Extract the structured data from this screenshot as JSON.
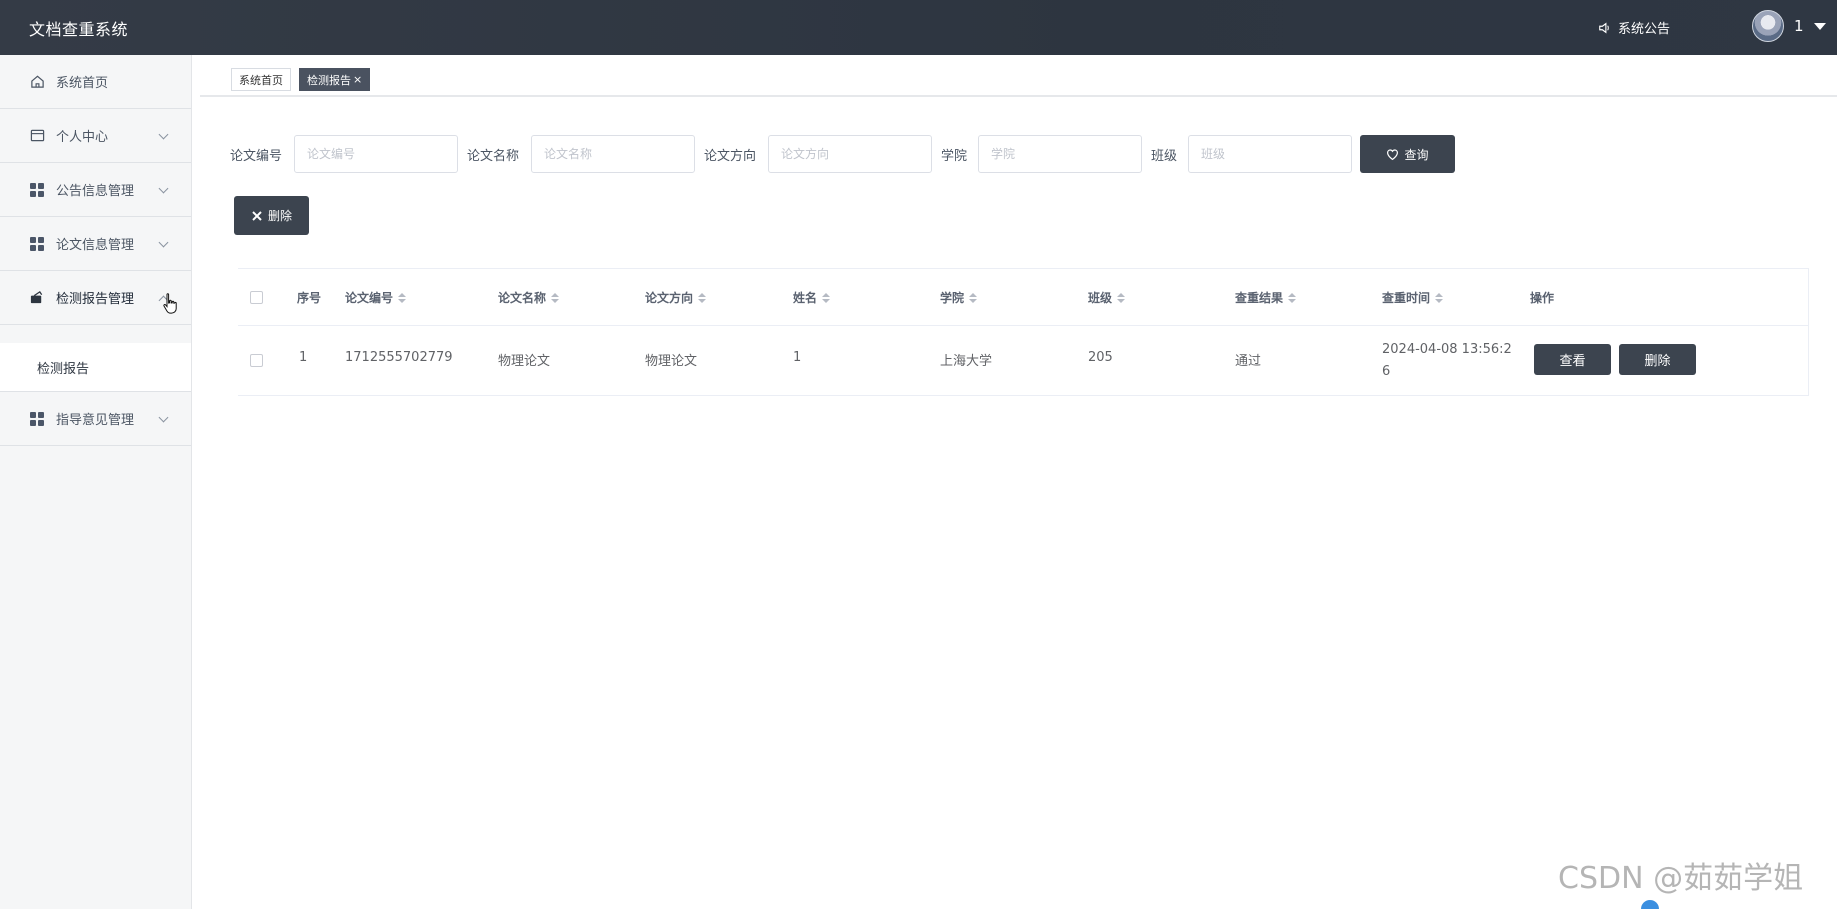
{
  "header": {
    "app_title": "文档查重系统",
    "notice_label": "系统公告",
    "user_name": "1"
  },
  "sidebar": {
    "items": [
      {
        "label": "系统首页",
        "icon": "home-icon"
      },
      {
        "label": "个人中心",
        "icon": "profile-card-icon"
      },
      {
        "label": "公告信息管理",
        "icon": "grid-icon"
      },
      {
        "label": "论文信息管理",
        "icon": "grid-icon"
      },
      {
        "label": "检测报告管理",
        "icon": "report-icon"
      },
      {
        "label": "指导意见管理",
        "icon": "grid-icon"
      }
    ],
    "submenu_label": "检测报告"
  },
  "tabs": {
    "home": "系统首页",
    "report": "检测报告",
    "close_glyph": "×"
  },
  "search": {
    "fields": [
      {
        "label": "论文编号",
        "placeholder": "论文编号"
      },
      {
        "label": "论文名称",
        "placeholder": "论文名称"
      },
      {
        "label": "论文方向",
        "placeholder": "论文方向"
      },
      {
        "label": "学院",
        "placeholder": "学院"
      },
      {
        "label": "班级",
        "placeholder": "班级"
      }
    ],
    "query_label": "查询"
  },
  "toolbar": {
    "delete_label": "删除"
  },
  "table": {
    "headers": [
      "序号",
      "论文编号",
      "论文名称",
      "论文方向",
      "姓名",
      "学院",
      "班级",
      "查重结果",
      "查重时间",
      "操作"
    ],
    "rows": [
      {
        "index": "1",
        "paper_no": "1712555702779",
        "paper_name": "物理论文",
        "direction": "物理论文",
        "name": "1",
        "college": "上海大学",
        "class": "205",
        "result": "通过",
        "time": "2024-04-08 13:56:26",
        "view_label": "查看",
        "delete_label": "删除"
      }
    ]
  },
  "watermark": "CSDN @茹茹学姐",
  "colors": {
    "header_bg": "#2d3540",
    "button_bg": "#3c444f",
    "sidebar_bg": "#f5f6f7"
  }
}
